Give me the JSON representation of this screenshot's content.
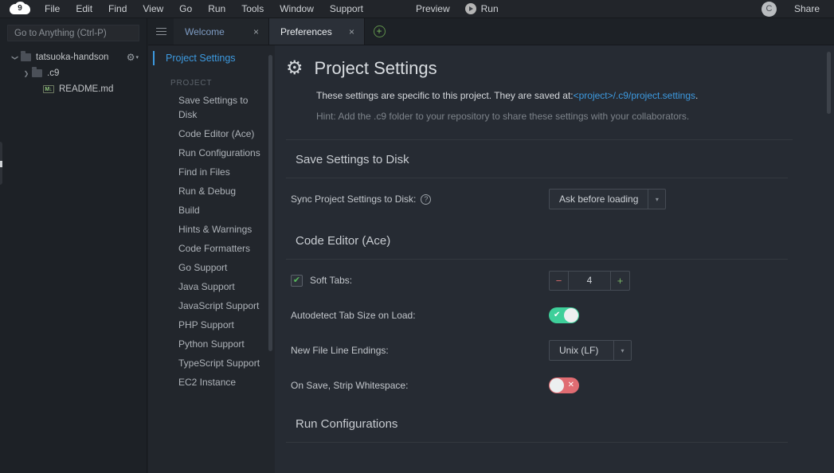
{
  "menubar": {
    "logo_text": "9",
    "items": [
      "File",
      "Edit",
      "Find",
      "View",
      "Go",
      "Run",
      "Tools",
      "Window",
      "Support"
    ],
    "preview_label": "Preview",
    "run_label": "Run",
    "avatar_initial": "C",
    "share_label": "Share"
  },
  "sidebar": {
    "search_placeholder": "Go to Anything (Ctrl-P)",
    "gear_caret": "▾",
    "tree": [
      {
        "label": "tatsuoka-handson",
        "type": "folder",
        "expanded": true,
        "twisty": "❯",
        "depth": 0
      },
      {
        "label": ".c9",
        "type": "folder",
        "expanded": false,
        "twisty": "❯",
        "depth": 1
      },
      {
        "label": "README.md",
        "type": "markdown",
        "icon_text": "M↓",
        "depth": 2
      }
    ]
  },
  "tabs": {
    "menu_icon": "hamburger-icon",
    "items": [
      {
        "label": "Welcome",
        "active": false,
        "close": "×"
      },
      {
        "label": "Preferences",
        "active": true,
        "close": "×"
      }
    ],
    "new_tab": "+"
  },
  "prefs_nav": {
    "root_label": "Project Settings",
    "group_label": "PROJECT",
    "items": [
      "Save Settings to Disk",
      "Code Editor (Ace)",
      "Run Configurations",
      "Find in Files",
      "Run & Debug",
      "Build",
      "Hints & Warnings",
      "Code Formatters",
      "Go Support",
      "Java Support",
      "JavaScript Support",
      "PHP Support",
      "Python Support",
      "TypeScript Support",
      "EC2 Instance"
    ]
  },
  "page": {
    "gear_icon": "⚙",
    "title": "Project Settings",
    "desc_prefix": "These settings are specific to this project. They are saved at:",
    "desc_link": "<project>/.c9/project.settings",
    "desc_suffix": ".",
    "hint": "Hint: Add the .c9 folder to your repository to share these settings with your collaborators."
  },
  "sections": {
    "save_settings": {
      "title": "Save Settings to Disk",
      "sync_label": "Sync Project Settings to Disk:",
      "help_glyph": "?",
      "sync_value": "Ask before loading",
      "caret": "▾"
    },
    "code_editor": {
      "title": "Code Editor (Ace)",
      "soft_tabs_label": "Soft Tabs:",
      "soft_tabs_checked": true,
      "soft_tabs_check_glyph": "✔",
      "tab_size_value": "4",
      "tab_minus": "−",
      "tab_plus": "+",
      "autodetect_label": "Autodetect Tab Size on Load:",
      "autodetect_state": "on",
      "autodetect_glyph": "✔",
      "line_endings_label": "New File Line Endings:",
      "line_endings_value": "Unix (LF)",
      "line_endings_caret": "▾",
      "strip_ws_label": "On Save, Strip Whitespace:",
      "strip_ws_state": "off",
      "strip_ws_glyph": "✕"
    },
    "run_configurations": {
      "title": "Run Configurations"
    }
  },
  "colors": {
    "accent_blue": "#3d9ae0",
    "toggle_on": "#3ecf9a",
    "toggle_off": "#e06c72",
    "check_green": "#57b85c",
    "panel_bg": "#22262c",
    "content_bg": "#262b33"
  }
}
